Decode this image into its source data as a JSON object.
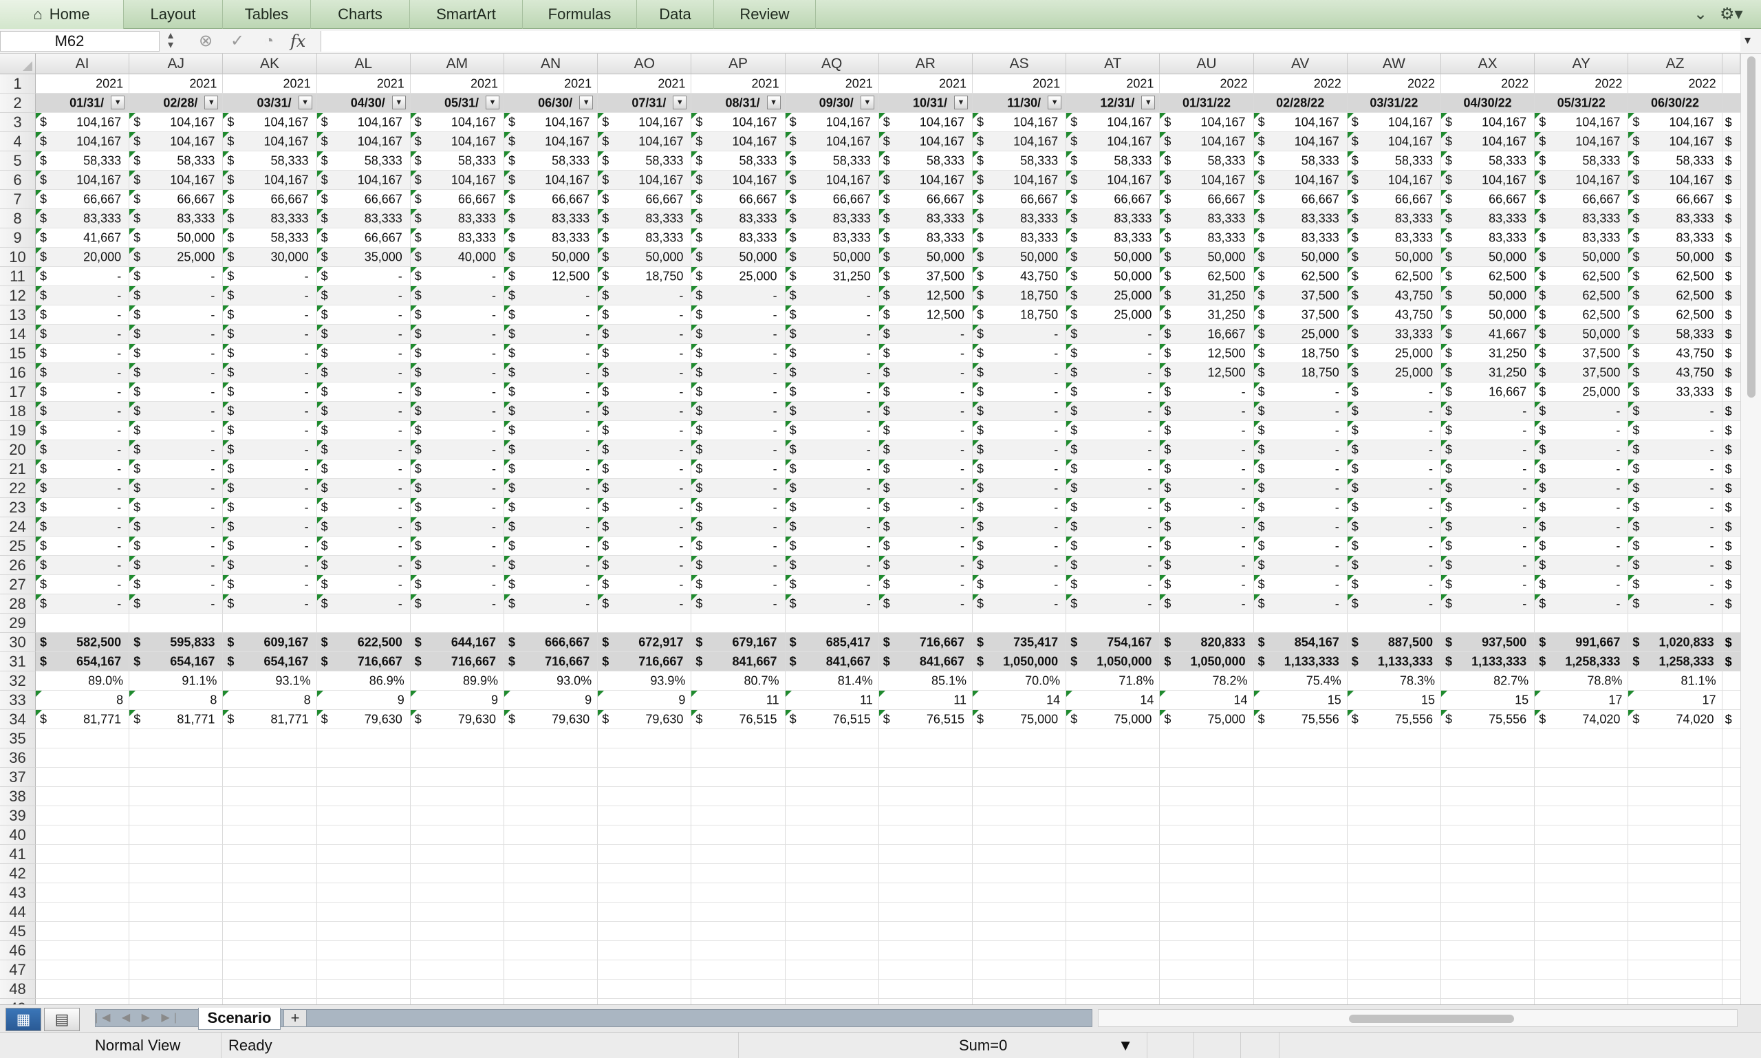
{
  "ribbon": {
    "tabs": [
      "Home",
      "Layout",
      "Tables",
      "Charts",
      "SmartArt",
      "Formulas",
      "Data",
      "Review"
    ],
    "home_icon": "home-icon",
    "collapse_icon": "chevron-down-icon",
    "settings_icon": "gear-icon"
  },
  "formula_bar": {
    "name_box": "M62",
    "cancel_icon": "circle-x-icon",
    "confirm_icon": "circle-check-icon",
    "function_icon": "function-icon",
    "fx_label": "fx",
    "formula": ""
  },
  "grid": {
    "columns": [
      "AI",
      "AJ",
      "AK",
      "AL",
      "AM",
      "AN",
      "AO",
      "AP",
      "AQ",
      "AR",
      "AS",
      "AT",
      "AU",
      "AV",
      "AW",
      "AX",
      "AY",
      "AZ"
    ],
    "row_numbers": [
      1,
      2,
      3,
      4,
      5,
      6,
      7,
      8,
      9,
      10,
      11,
      12,
      13,
      14,
      15,
      16,
      17,
      18,
      19,
      20,
      21,
      22,
      23,
      24,
      25,
      26,
      27,
      28,
      29,
      30,
      31,
      32,
      33,
      34,
      35,
      36,
      37,
      38,
      39,
      40,
      41,
      42,
      43,
      44,
      45,
      46,
      47,
      48,
      49
    ],
    "year_row": [
      "2021",
      "2021",
      "2021",
      "2021",
      "2021",
      "2021",
      "2021",
      "2021",
      "2021",
      "2021",
      "2021",
      "2021",
      "2022",
      "2022",
      "2022",
      "2022",
      "2022",
      "2022"
    ],
    "date_row": [
      "01/31/",
      "02/28/",
      "03/31/",
      "04/30/",
      "05/31/",
      "06/30/",
      "07/31/",
      "08/31/",
      "09/30/",
      "10/31/",
      "11/30/",
      "12/31/",
      "01/31/22",
      "02/28/22",
      "03/31/22",
      "04/30/22",
      "05/31/22",
      "06/30/22"
    ],
    "currency_symbol": "$",
    "data_rows": [
      [
        "104,167",
        "104,167",
        "104,167",
        "104,167",
        "104,167",
        "104,167",
        "104,167",
        "104,167",
        "104,167",
        "104,167",
        "104,167",
        "104,167",
        "104,167",
        "104,167",
        "104,167",
        "104,167",
        "104,167",
        "104,167"
      ],
      [
        "104,167",
        "104,167",
        "104,167",
        "104,167",
        "104,167",
        "104,167",
        "104,167",
        "104,167",
        "104,167",
        "104,167",
        "104,167",
        "104,167",
        "104,167",
        "104,167",
        "104,167",
        "104,167",
        "104,167",
        "104,167"
      ],
      [
        "58,333",
        "58,333",
        "58,333",
        "58,333",
        "58,333",
        "58,333",
        "58,333",
        "58,333",
        "58,333",
        "58,333",
        "58,333",
        "58,333",
        "58,333",
        "58,333",
        "58,333",
        "58,333",
        "58,333",
        "58,333"
      ],
      [
        "104,167",
        "104,167",
        "104,167",
        "104,167",
        "104,167",
        "104,167",
        "104,167",
        "104,167",
        "104,167",
        "104,167",
        "104,167",
        "104,167",
        "104,167",
        "104,167",
        "104,167",
        "104,167",
        "104,167",
        "104,167"
      ],
      [
        "66,667",
        "66,667",
        "66,667",
        "66,667",
        "66,667",
        "66,667",
        "66,667",
        "66,667",
        "66,667",
        "66,667",
        "66,667",
        "66,667",
        "66,667",
        "66,667",
        "66,667",
        "66,667",
        "66,667",
        "66,667"
      ],
      [
        "83,333",
        "83,333",
        "83,333",
        "83,333",
        "83,333",
        "83,333",
        "83,333",
        "83,333",
        "83,333",
        "83,333",
        "83,333",
        "83,333",
        "83,333",
        "83,333",
        "83,333",
        "83,333",
        "83,333",
        "83,333"
      ],
      [
        "41,667",
        "50,000",
        "58,333",
        "66,667",
        "83,333",
        "83,333",
        "83,333",
        "83,333",
        "83,333",
        "83,333",
        "83,333",
        "83,333",
        "83,333",
        "83,333",
        "83,333",
        "83,333",
        "83,333",
        "83,333"
      ],
      [
        "20,000",
        "25,000",
        "30,000",
        "35,000",
        "40,000",
        "50,000",
        "50,000",
        "50,000",
        "50,000",
        "50,000",
        "50,000",
        "50,000",
        "50,000",
        "50,000",
        "50,000",
        "50,000",
        "50,000",
        "50,000"
      ],
      [
        "-",
        "-",
        "-",
        "-",
        "-",
        "12,500",
        "18,750",
        "25,000",
        "31,250",
        "37,500",
        "43,750",
        "50,000",
        "62,500",
        "62,500",
        "62,500",
        "62,500",
        "62,500",
        "62,500"
      ],
      [
        "-",
        "-",
        "-",
        "-",
        "-",
        "-",
        "-",
        "-",
        "-",
        "12,500",
        "18,750",
        "25,000",
        "31,250",
        "37,500",
        "43,750",
        "50,000",
        "62,500",
        "62,500"
      ],
      [
        "-",
        "-",
        "-",
        "-",
        "-",
        "-",
        "-",
        "-",
        "-",
        "12,500",
        "18,750",
        "25,000",
        "31,250",
        "37,500",
        "43,750",
        "50,000",
        "62,500",
        "62,500"
      ],
      [
        "-",
        "-",
        "-",
        "-",
        "-",
        "-",
        "-",
        "-",
        "-",
        "-",
        "-",
        "-",
        "16,667",
        "25,000",
        "33,333",
        "41,667",
        "50,000",
        "58,333"
      ],
      [
        "-",
        "-",
        "-",
        "-",
        "-",
        "-",
        "-",
        "-",
        "-",
        "-",
        "-",
        "-",
        "12,500",
        "18,750",
        "25,000",
        "31,250",
        "37,500",
        "43,750"
      ],
      [
        "-",
        "-",
        "-",
        "-",
        "-",
        "-",
        "-",
        "-",
        "-",
        "-",
        "-",
        "-",
        "12,500",
        "18,750",
        "25,000",
        "31,250",
        "37,500",
        "43,750"
      ],
      [
        "-",
        "-",
        "-",
        "-",
        "-",
        "-",
        "-",
        "-",
        "-",
        "-",
        "-",
        "-",
        "-",
        "-",
        "-",
        "16,667",
        "25,000",
        "33,333"
      ],
      [
        "-",
        "-",
        "-",
        "-",
        "-",
        "-",
        "-",
        "-",
        "-",
        "-",
        "-",
        "-",
        "-",
        "-",
        "-",
        "-",
        "-",
        "-"
      ],
      [
        "-",
        "-",
        "-",
        "-",
        "-",
        "-",
        "-",
        "-",
        "-",
        "-",
        "-",
        "-",
        "-",
        "-",
        "-",
        "-",
        "-",
        "-"
      ],
      [
        "-",
        "-",
        "-",
        "-",
        "-",
        "-",
        "-",
        "-",
        "-",
        "-",
        "-",
        "-",
        "-",
        "-",
        "-",
        "-",
        "-",
        "-"
      ],
      [
        "-",
        "-",
        "-",
        "-",
        "-",
        "-",
        "-",
        "-",
        "-",
        "-",
        "-",
        "-",
        "-",
        "-",
        "-",
        "-",
        "-",
        "-"
      ],
      [
        "-",
        "-",
        "-",
        "-",
        "-",
        "-",
        "-",
        "-",
        "-",
        "-",
        "-",
        "-",
        "-",
        "-",
        "-",
        "-",
        "-",
        "-"
      ],
      [
        "-",
        "-",
        "-",
        "-",
        "-",
        "-",
        "-",
        "-",
        "-",
        "-",
        "-",
        "-",
        "-",
        "-",
        "-",
        "-",
        "-",
        "-"
      ],
      [
        "-",
        "-",
        "-",
        "-",
        "-",
        "-",
        "-",
        "-",
        "-",
        "-",
        "-",
        "-",
        "-",
        "-",
        "-",
        "-",
        "-",
        "-"
      ],
      [
        "-",
        "-",
        "-",
        "-",
        "-",
        "-",
        "-",
        "-",
        "-",
        "-",
        "-",
        "-",
        "-",
        "-",
        "-",
        "-",
        "-",
        "-"
      ],
      [
        "-",
        "-",
        "-",
        "-",
        "-",
        "-",
        "-",
        "-",
        "-",
        "-",
        "-",
        "-",
        "-",
        "-",
        "-",
        "-",
        "-",
        "-"
      ],
      [
        "-",
        "-",
        "-",
        "-",
        "-",
        "-",
        "-",
        "-",
        "-",
        "-",
        "-",
        "-",
        "-",
        "-",
        "-",
        "-",
        "-",
        "-"
      ],
      [
        "-",
        "-",
        "-",
        "-",
        "-",
        "-",
        "-",
        "-",
        "-",
        "-",
        "-",
        "-",
        "-",
        "-",
        "-",
        "-",
        "-",
        "-"
      ]
    ],
    "total_row_30": [
      "582,500",
      "595,833",
      "609,167",
      "622,500",
      "644,167",
      "666,667",
      "672,917",
      "679,167",
      "685,417",
      "716,667",
      "735,417",
      "754,167",
      "820,833",
      "854,167",
      "887,500",
      "937,500",
      "991,667",
      "1,020,833"
    ],
    "total_row_31": [
      "654,167",
      "654,167",
      "654,167",
      "716,667",
      "716,667",
      "716,667",
      "716,667",
      "841,667",
      "841,667",
      "841,667",
      "1,050,000",
      "1,050,000",
      "1,050,000",
      "1,133,333",
      "1,133,333",
      "1,133,333",
      "1,258,333",
      "1,258,333"
    ],
    "pct_row_32": [
      "89.0%",
      "91.1%",
      "93.1%",
      "86.9%",
      "89.9%",
      "93.0%",
      "93.9%",
      "80.7%",
      "81.4%",
      "85.1%",
      "70.0%",
      "71.8%",
      "78.2%",
      "75.4%",
      "78.3%",
      "82.7%",
      "78.8%",
      "81.1%"
    ],
    "count_row_33": [
      "8",
      "8",
      "8",
      "9",
      "9",
      "9",
      "9",
      "11",
      "11",
      "11",
      "14",
      "14",
      "14",
      "15",
      "15",
      "15",
      "17",
      "17"
    ],
    "avg_row_34": [
      "81,771",
      "81,771",
      "81,771",
      "79,630",
      "79,630",
      "79,630",
      "79,630",
      "76,515",
      "76,515",
      "76,515",
      "75,000",
      "75,000",
      "75,000",
      "75,556",
      "75,556",
      "75,556",
      "74,020",
      "74,020"
    ]
  },
  "sheets": {
    "active": "Scenario",
    "add_label": "+",
    "nav_label": "|◀ ◀ ▶ ▶|"
  },
  "view_buttons": {
    "normal_icon": "normal-view-icon",
    "layout_icon": "page-layout-icon"
  },
  "status": {
    "view": "Normal View",
    "state": "Ready",
    "sum": "Sum=0"
  },
  "colors": {
    "ribbon": "#c8e0c0",
    "header_gray": "#d9d9d9",
    "total_gray": "#d6d6d6",
    "band": "#f2f2f2",
    "error_triangle": "#1f8a2e"
  }
}
